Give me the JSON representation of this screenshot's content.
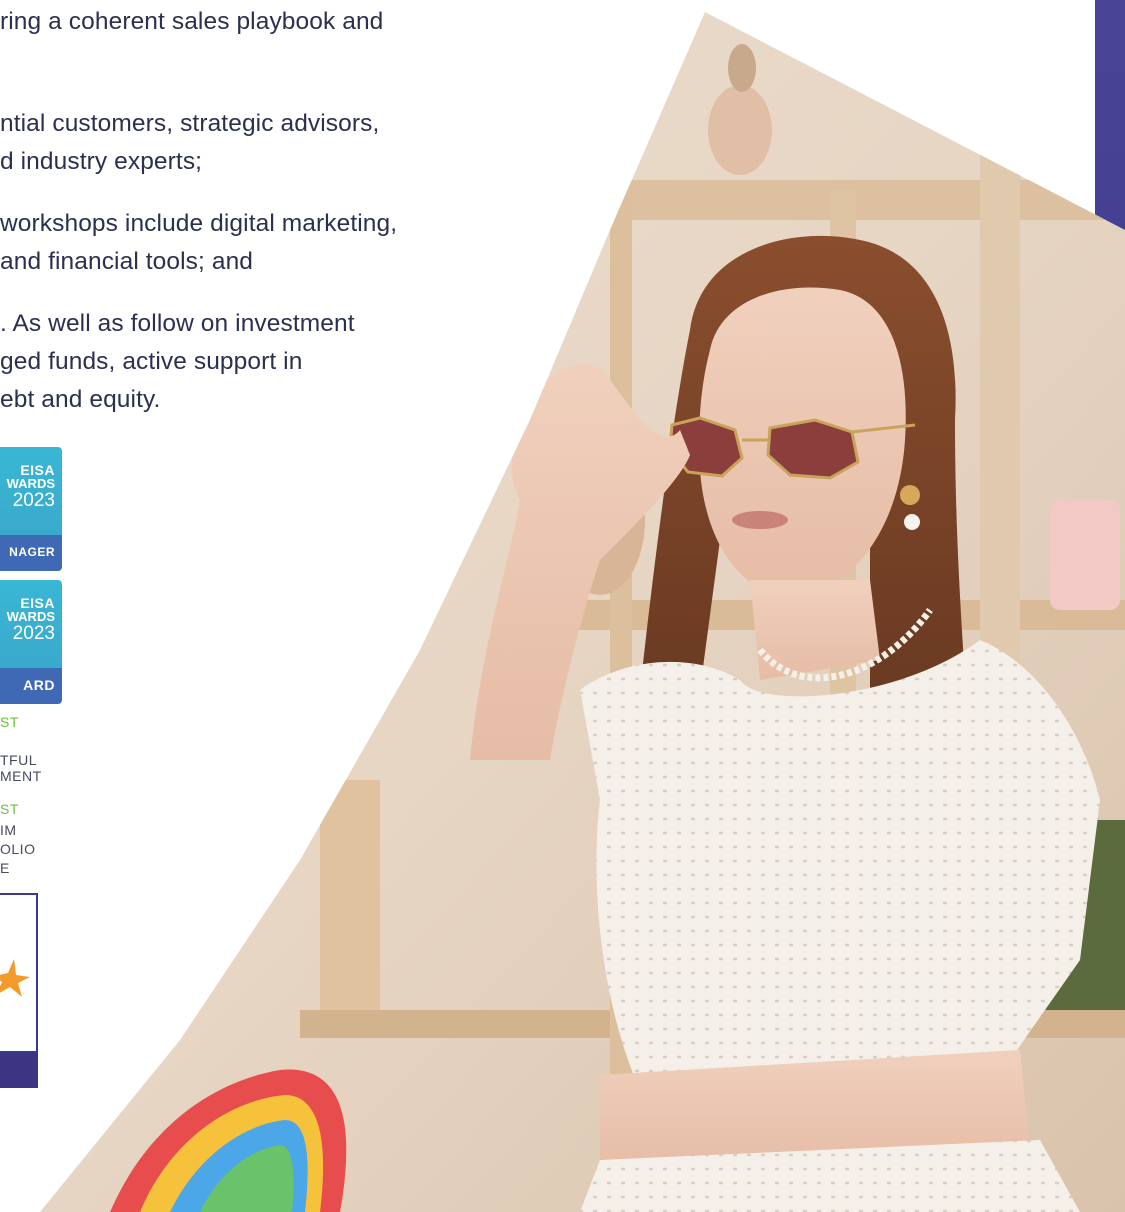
{
  "copy": {
    "line1": "ring a coherent sales playbook and",
    "line2": "ntial customers, strategic advisors,",
    "line3": "d industry experts;",
    "line4": "workshops include digital marketing,",
    "line5": " and financial tools; and",
    "line6": ". As well as follow on investment",
    "line7": "ged funds, active support in",
    "line8": "ebt and equity."
  },
  "awards": [
    {
      "l1": "EISA",
      "l2": "WARDS",
      "l3": "2023",
      "bottom": "NAGER"
    },
    {
      "l1": "EISA",
      "l2": "WARDS",
      "l3": "2023",
      "bottom": "ARD"
    }
  ],
  "shortlist1": {
    "tag": "ST",
    "lines": [
      "TFUL",
      "MENT"
    ]
  },
  "shortlist2": {
    "tag": "ST",
    "lines": [
      "IM",
      "OLIO",
      "E"
    ]
  },
  "colors": {
    "purple": "#3e3a8a",
    "award_cyan": "#39b7d4",
    "award_blue": "#3f69b5",
    "shortlist_green": "#67c23e",
    "star_orange": "#f39a2b"
  },
  "icons": {
    "badge_star": "star-icon"
  }
}
